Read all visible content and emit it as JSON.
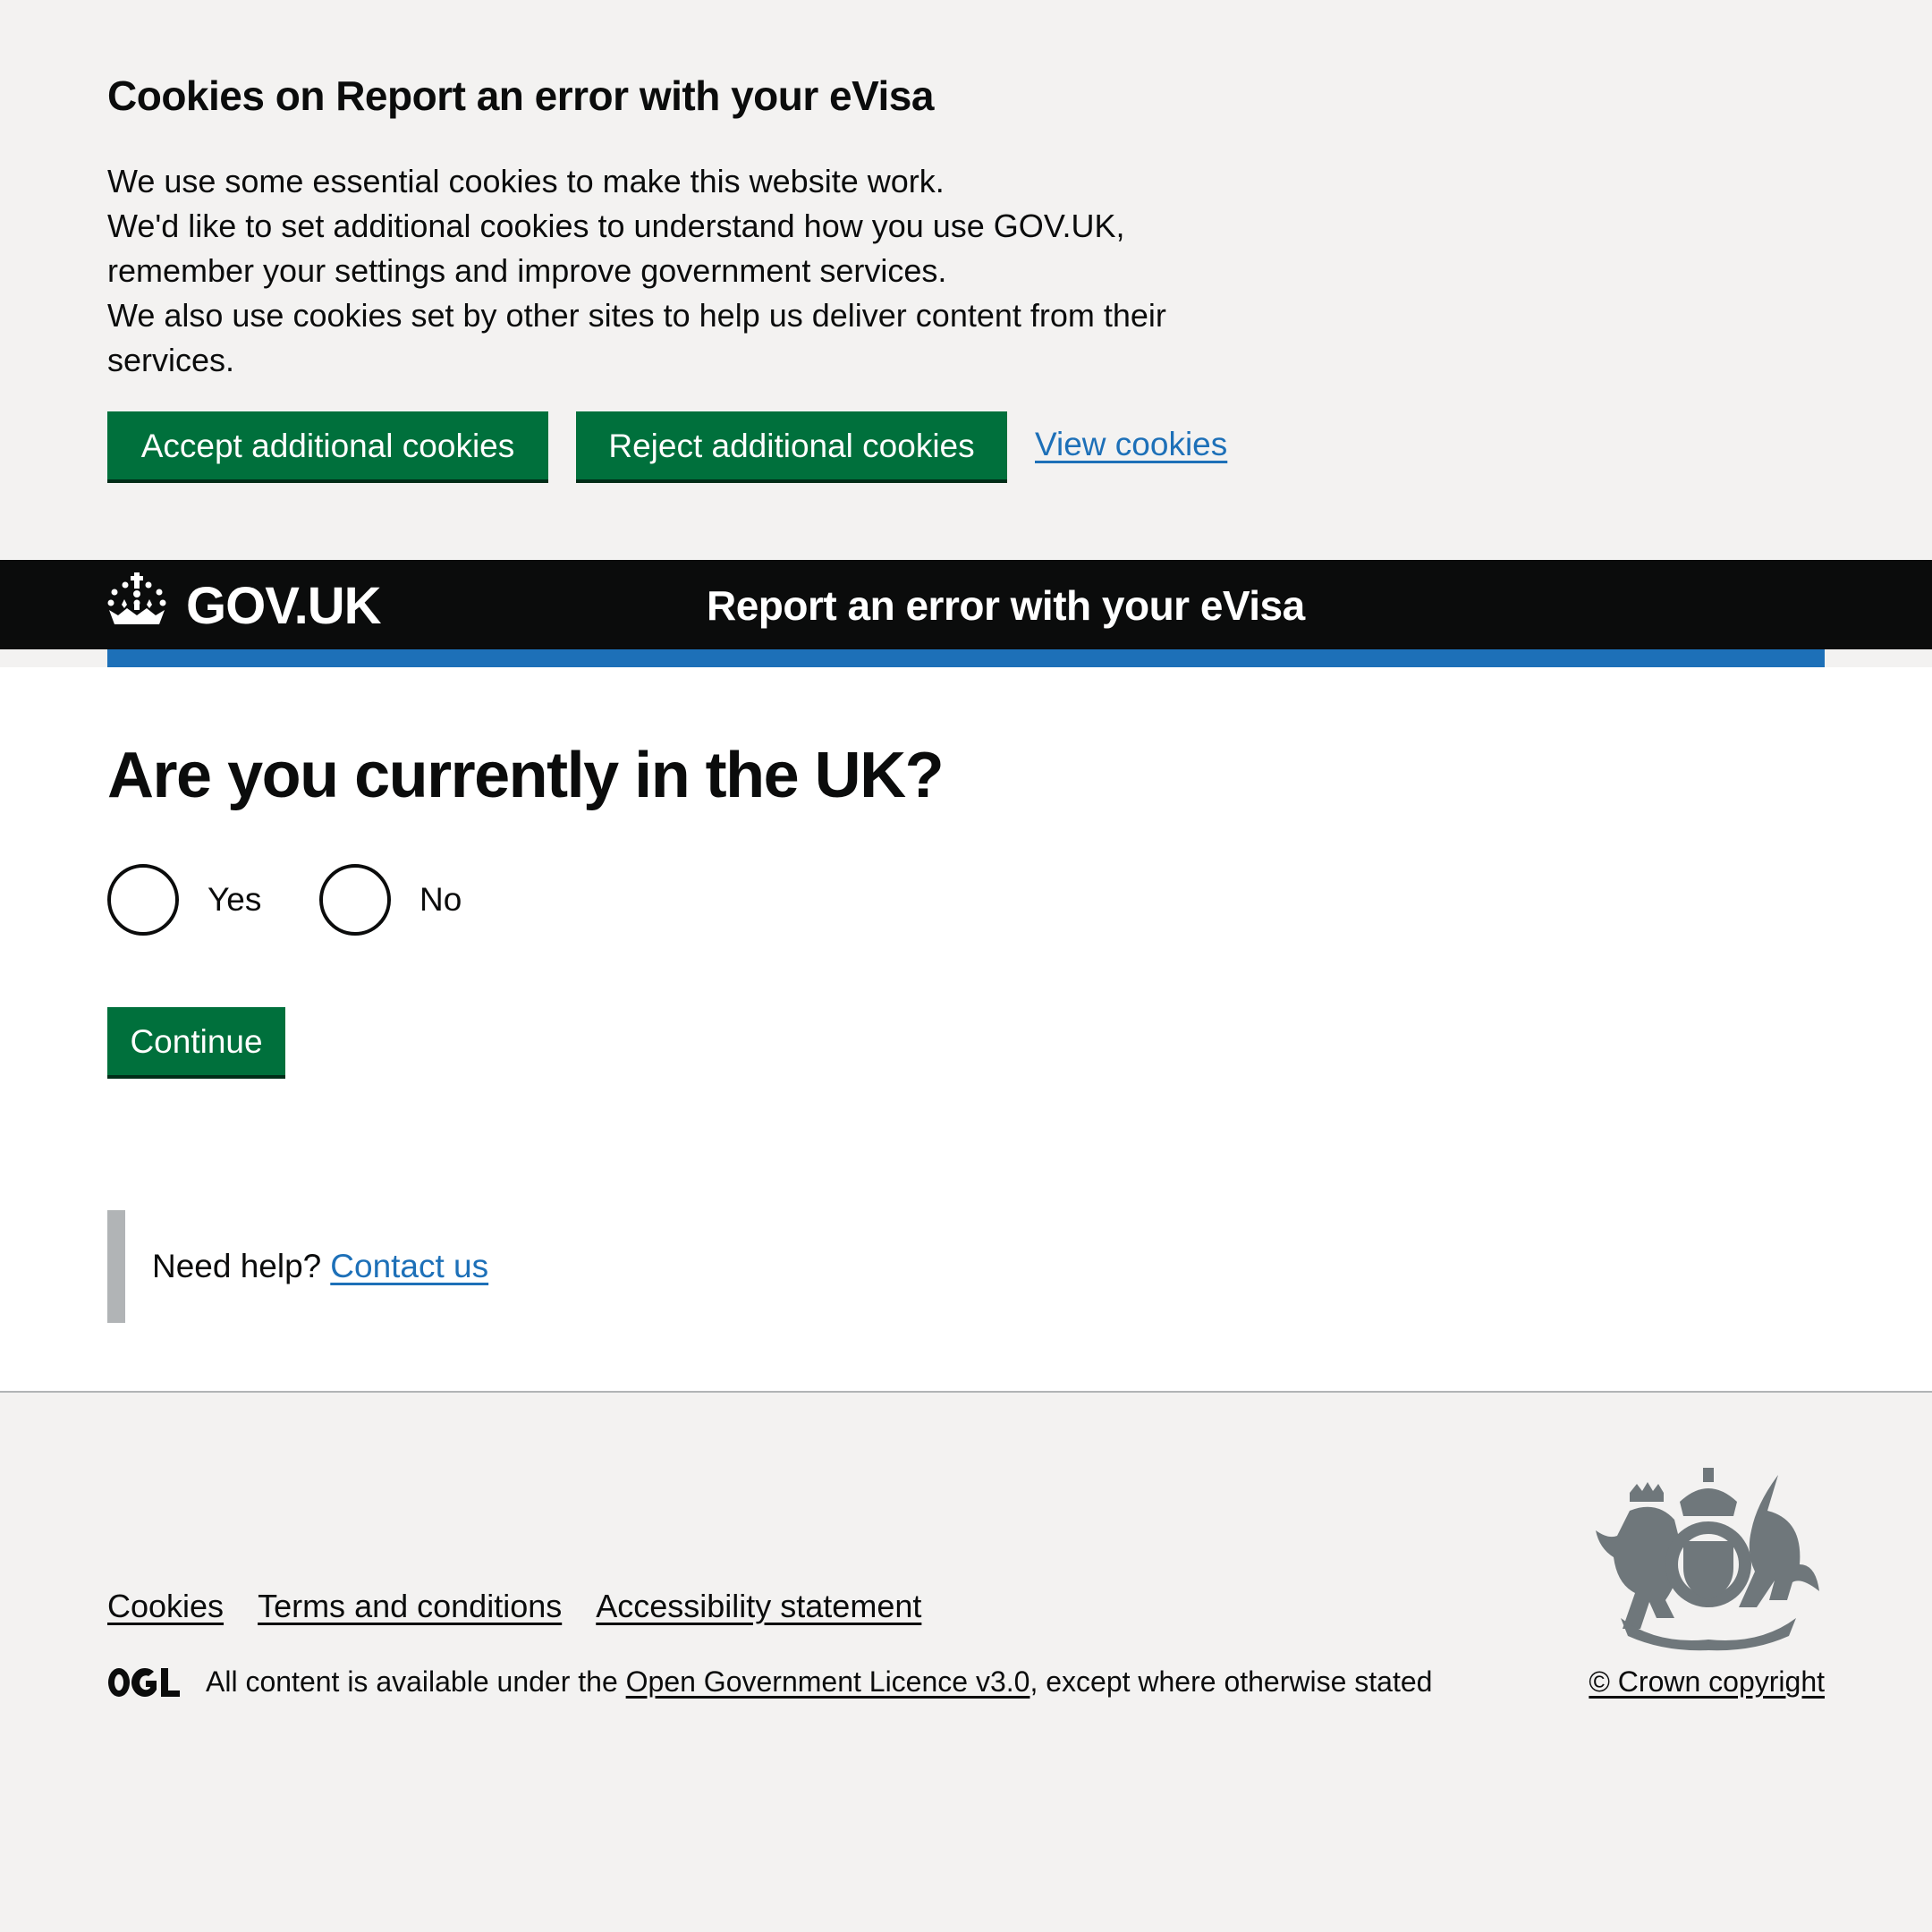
{
  "cookie_banner": {
    "title": "Cookies on Report an error with your eVisa",
    "paragraphs": [
      "We use some essential cookies to make this website work.",
      "We'd like to set additional cookies to understand how you use GOV.UK, remember your settings and improve government services.",
      "We also use cookies set by other sites to help us deliver content from their services."
    ],
    "accept_label": "Accept additional cookies",
    "reject_label": "Reject additional cookies",
    "view_label": "View cookies"
  },
  "header": {
    "logo_icon": "crown-icon",
    "logotype": "GOV.UK",
    "service_name": "Report an error with your eVisa"
  },
  "main": {
    "question": "Are you currently in the UK?",
    "options": [
      {
        "label": "Yes",
        "selected": false
      },
      {
        "label": "No",
        "selected": false
      }
    ],
    "continue_label": "Continue",
    "help_text": "Need help?",
    "help_link": "Contact us"
  },
  "footer": {
    "links": [
      "Cookies",
      "Terms and conditions",
      "Accessibility statement"
    ],
    "licence_logo": "OGL",
    "licence_prefix": "All content is available under the",
    "licence_link": "Open Government Licence v3.0",
    "licence_suffix": ", except where otherwise stated",
    "crest_icon": "royal-coat-of-arms-icon",
    "copyright": "© Crown copyright"
  },
  "colors": {
    "brand_green": "#00703c",
    "link_blue": "#1d70b8",
    "header_black": "#0b0c0c",
    "background_grey": "#f3f2f1",
    "border_grey": "#b1b4b6"
  }
}
